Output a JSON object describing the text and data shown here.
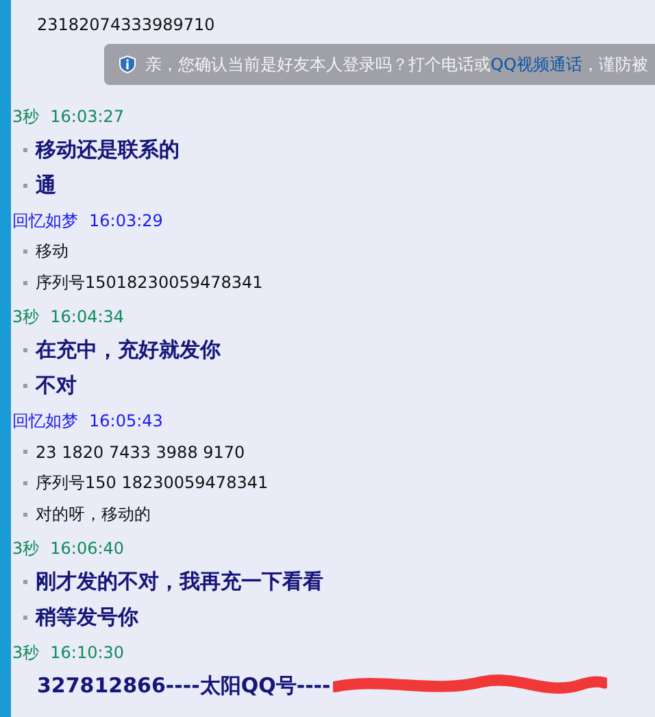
{
  "messages": [
    {
      "kind": "plain",
      "lines": [
        {
          "text": "23182074333989710",
          "bullet": false
        }
      ]
    },
    {
      "kind": "notice",
      "parts": [
        {
          "text": "亲，您确认当前是好友本人登录吗？打个电话或 ",
          "link": false
        },
        {
          "text": "QQ视频通话",
          "link": true
        },
        {
          "text": "，谨防被",
          "link": false
        }
      ]
    },
    {
      "kind": "contact",
      "sender": "3秒",
      "time": "16:03:27",
      "lines": [
        {
          "text": "移动还是联系的",
          "bullet": true
        },
        {
          "text": "通",
          "bullet": true
        }
      ]
    },
    {
      "kind": "self",
      "sender": "回忆如梦",
      "time": "16:03:29",
      "lines": [
        {
          "text": "移动",
          "bullet": true
        },
        {
          "text": "序列号15018230059478341",
          "bullet": true
        }
      ]
    },
    {
      "kind": "contact",
      "sender": "3秒",
      "time": "16:04:34",
      "lines": [
        {
          "text": "在充中，充好就发你",
          "bullet": true
        },
        {
          "text": "不对",
          "bullet": true
        }
      ]
    },
    {
      "kind": "self",
      "sender": "回忆如梦",
      "time": "16:05:43",
      "lines": [
        {
          "text": "23 1820 7433 3988 9170",
          "bullet": true
        },
        {
          "text": "序列号150 18230059478341",
          "bullet": true
        },
        {
          "text": "对的呀，移动的",
          "bullet": true
        }
      ]
    },
    {
      "kind": "contact",
      "sender": "3秒",
      "time": "16:06:40",
      "lines": [
        {
          "text": "刚才发的不对，我再充一下看看",
          "bullet": true
        },
        {
          "text": "稍等发号你",
          "bullet": true
        }
      ]
    },
    {
      "kind": "contact",
      "sender": "3秒",
      "time": "16:10:30",
      "lines": [
        {
          "text": "327812866----太阳QQ号----",
          "bullet": false,
          "redacted": true
        }
      ]
    }
  ]
}
